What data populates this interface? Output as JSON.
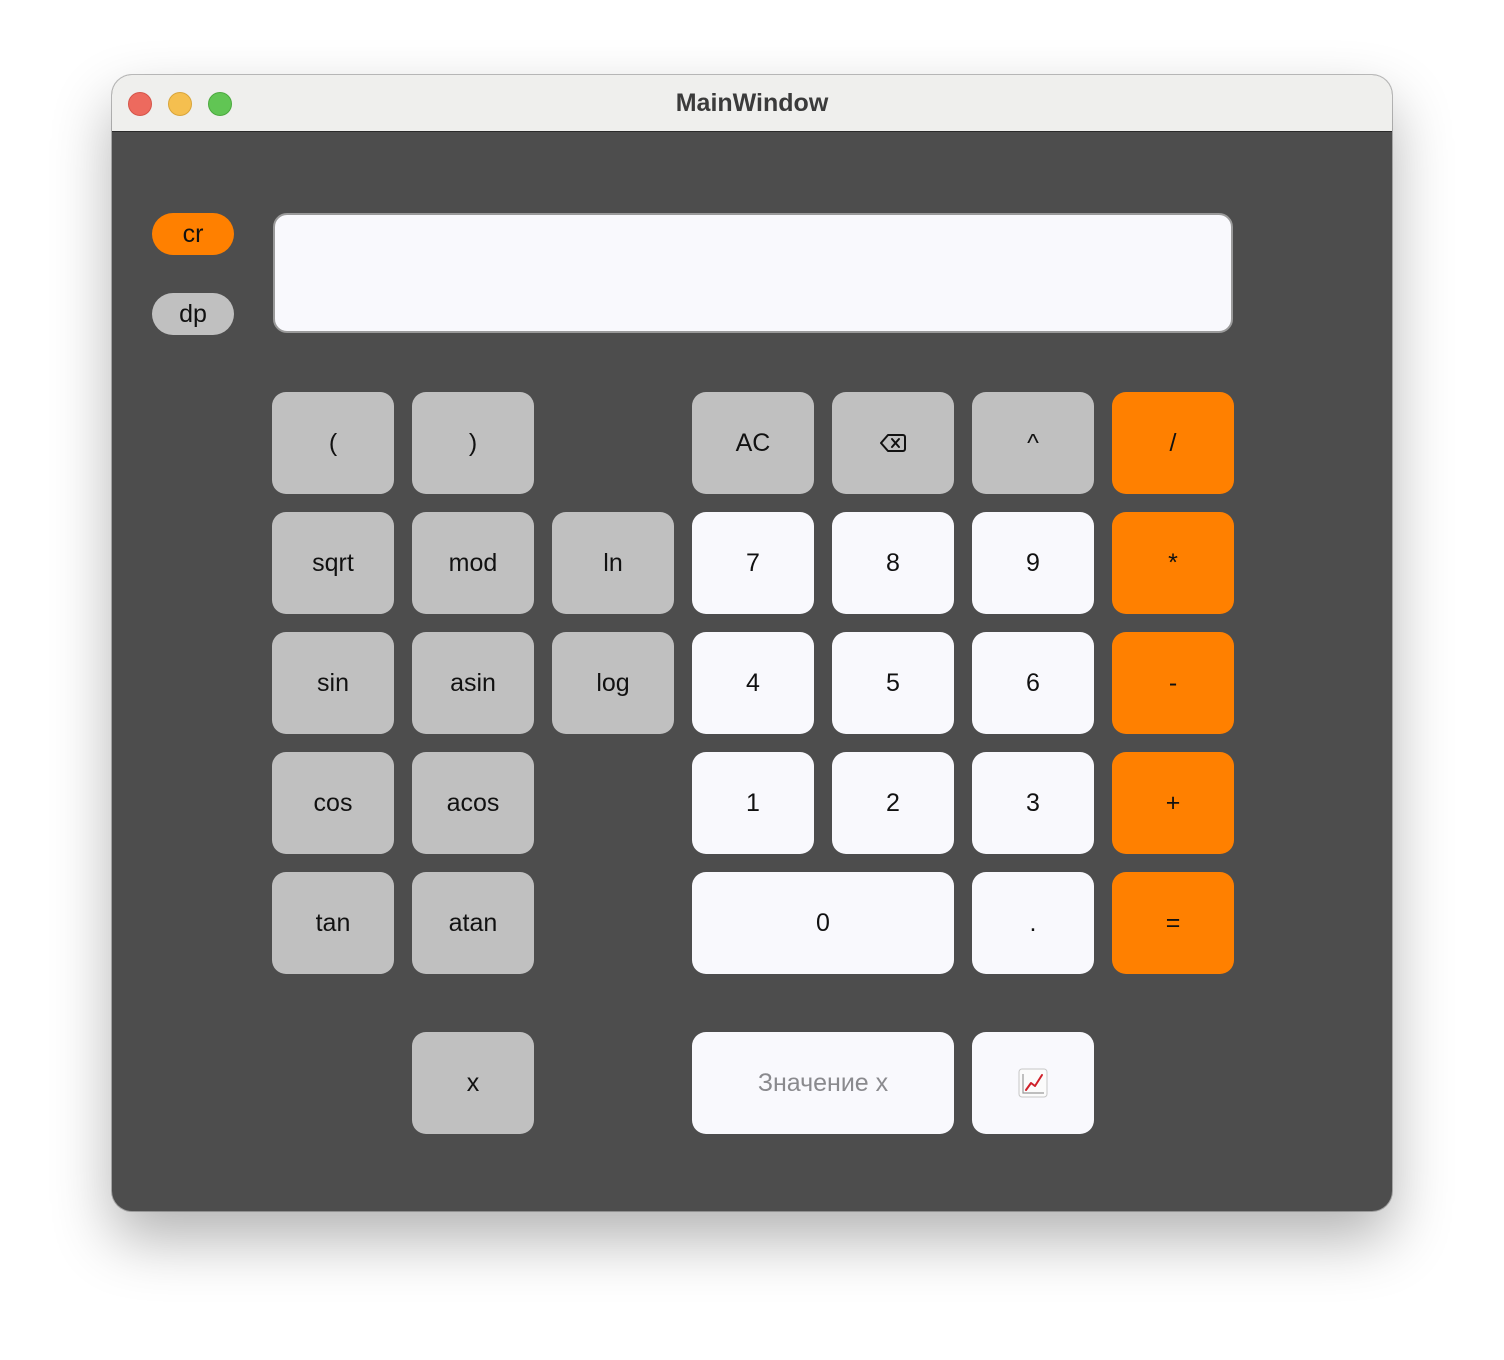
{
  "window": {
    "title": "MainWindow"
  },
  "mode_buttons": {
    "cr_label": "cr",
    "dp_label": "dp"
  },
  "display": {
    "value": ""
  },
  "keys": {
    "open_paren": "(",
    "close_paren": ")",
    "all_clear": "AC",
    "backspace_icon": "backspace-icon",
    "power": "^",
    "divide": "/",
    "sqrt": "sqrt",
    "mod": "mod",
    "ln": "ln",
    "seven": "7",
    "eight": "8",
    "nine": "9",
    "multiply": "*",
    "sin": "sin",
    "asin": "asin",
    "log": "log",
    "four": "4",
    "five": "5",
    "six": "6",
    "minus": "-",
    "cos": "cos",
    "acos": "acos",
    "one": "1",
    "two": "2",
    "three": "3",
    "plus": "+",
    "tan": "tan",
    "atan": "atan",
    "zero": "0",
    "dot": ".",
    "equals": "=",
    "x": "x"
  },
  "x_value": {
    "placeholder": "Значение x",
    "value": ""
  },
  "graph_button": {
    "icon": "chart-increasing-icon"
  },
  "colors": {
    "window_bg": "#4d4d4d",
    "function_key": "#c0c0c0",
    "number_key": "#f9f9fd",
    "operator_key": "#ff8000"
  }
}
